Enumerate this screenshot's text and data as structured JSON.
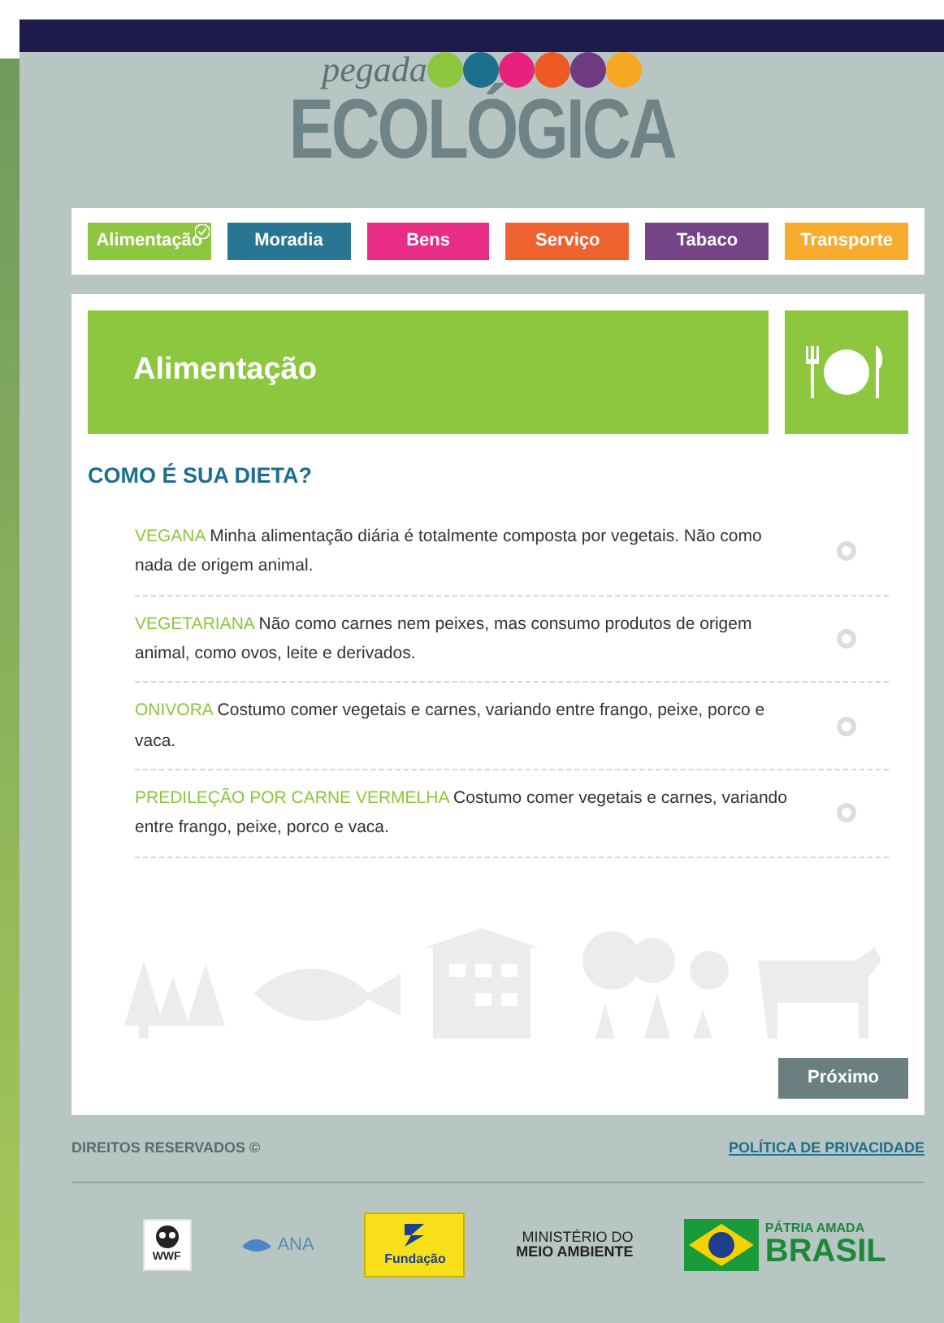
{
  "logo": {
    "script": "pegada",
    "title": "ECOLÓGICA"
  },
  "tabs": [
    {
      "label": "Alimentação",
      "color": "#8dc63f",
      "selected": true
    },
    {
      "label": "Moradia",
      "color": "#1d6f8e",
      "selected": false
    },
    {
      "label": "Bens",
      "color": "#e8217f",
      "selected": false
    },
    {
      "label": "Serviço",
      "color": "#ee5a24",
      "selected": false
    },
    {
      "label": "Tabaco",
      "color": "#6e3a80",
      "selected": false
    },
    {
      "label": "Transporte",
      "color": "#f7a823",
      "selected": false
    }
  ],
  "section": {
    "title": "Alimentação"
  },
  "question": "COMO É SUA DIETA?",
  "options": [
    {
      "label": "VEGANA",
      "text": "Minha alimentação diária é totalmente composta por vegetais. Não como nada de origem animal.",
      "selected": false
    },
    {
      "label": "VEGETARIANA",
      "text": "Não como carnes nem peixes, mas consumo produtos de origem animal, como ovos, leite e derivados.",
      "selected": false
    },
    {
      "label": "ONIVORA",
      "text": "Costumo comer vegetais e carnes, variando entre frango, peixe, porco e vaca.",
      "selected": false
    },
    {
      "label": "PREDILEÇÃO POR CARNE VERMELHA",
      "text": "Costumo comer vegetais e carnes, variando entre frango, peixe, porco e vaca.",
      "selected": false
    }
  ],
  "next_button": "Próximo",
  "footer": {
    "rights": "DIREITOS RESERVADOS ©",
    "privacy": "POLÍTICA DE PRIVACIDADE"
  },
  "sponsors": [
    {
      "kind": "wwf",
      "texts": [
        "WWF"
      ]
    },
    {
      "kind": "ana",
      "texts": [
        "ANA"
      ]
    },
    {
      "kind": "fundacao",
      "texts": [
        "Fundação"
      ]
    },
    {
      "kind": "ministerio",
      "texts": [
        "MINISTÉRIO DO",
        "MEIO AMBIENTE"
      ]
    },
    {
      "kind": "brasil",
      "texts": [
        "PÁTRIA AMADA",
        "BRASIL"
      ]
    }
  ]
}
